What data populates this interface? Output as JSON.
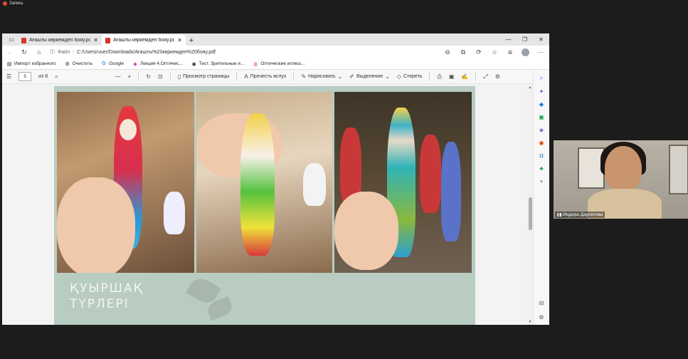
{
  "recording": {
    "label": "Запись"
  },
  "browser": {
    "tabs": [
      {
        "label": "Ағашты көркемдеп бояу.pdf",
        "active": false
      },
      {
        "label": "Ағашты көркемдеп бояу.pdf",
        "active": true
      }
    ],
    "address": {
      "file_label": "Файл",
      "url": "C:/Users/user/Downloads/Ағашты%20көркемдеп%20бояу.pdf"
    },
    "favorites": [
      {
        "label": "Импорт избранного",
        "icon": "folder-icon"
      },
      {
        "label": "Очистить",
        "icon": "gear-icon"
      },
      {
        "label": "Google",
        "icon": "google-icon"
      },
      {
        "label": "Лекция 4.Оптичес...",
        "icon": "bookmark-icon"
      },
      {
        "label": "Тест. Зрительные и...",
        "icon": "globe-icon"
      },
      {
        "label": "Оптические иллюз...",
        "icon": "bookmark-icon"
      }
    ]
  },
  "pdf_toolbar": {
    "page_current": "5",
    "page_total": "из 8",
    "view_page": "Просмотр страницы",
    "read_aloud": "Прочесть вслух",
    "draw": "Нарисовать",
    "highlight": "Выделение",
    "erase": "Стереть"
  },
  "slide": {
    "title_line1": "ҚУЫРШАҚ",
    "title_line2": "ТҮРЛЕРІ"
  },
  "video": {
    "participant_name": "Индира Даулетова"
  },
  "colors": {
    "slide_bg": "#b9ccc1",
    "accent_edge": "#1a73e8"
  }
}
